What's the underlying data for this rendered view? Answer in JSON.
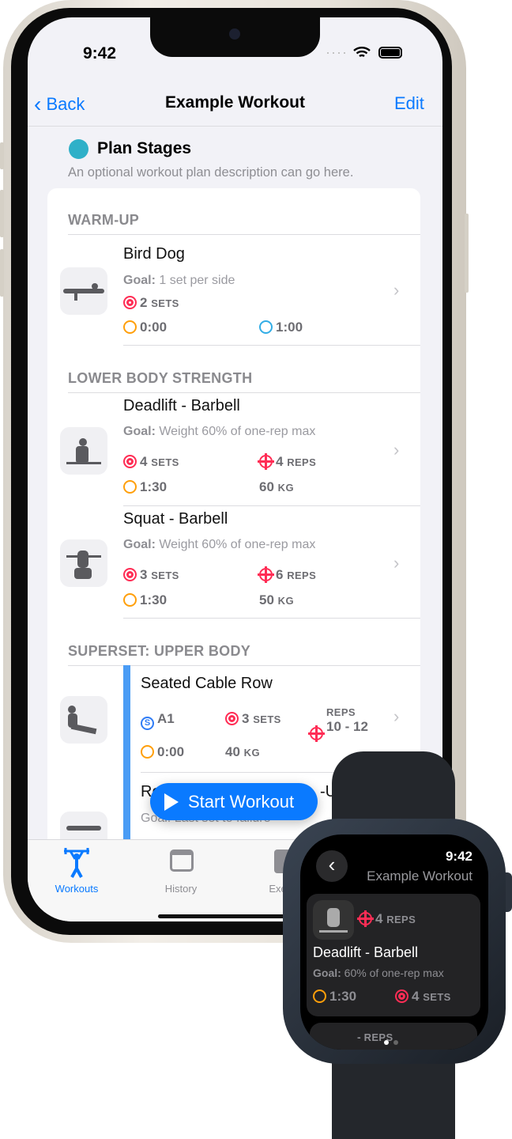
{
  "status": {
    "time": "9:42"
  },
  "nav": {
    "back": "Back",
    "title": "Example Workout",
    "edit": "Edit"
  },
  "plan": {
    "title": "Plan Stages",
    "description": "An optional workout plan description can go here."
  },
  "sections": [
    {
      "title": "WARM-UP",
      "items": [
        {
          "name": "Bird Dog",
          "goal_label": "Goal:",
          "goal": "1 set per side",
          "sets": "2",
          "sets_unit": "SETS",
          "rest": "0:00",
          "duration": "1:00"
        }
      ]
    },
    {
      "title": "LOWER BODY STRENGTH",
      "items": [
        {
          "name": "Deadlift - Barbell",
          "goal_label": "Goal:",
          "goal": "Weight 60% of one-rep max",
          "sets": "4",
          "sets_unit": "SETS",
          "reps": "4",
          "reps_unit": "REPS",
          "rest": "1:30",
          "weight": "60",
          "weight_unit": "KG"
        },
        {
          "name": "Squat - Barbell",
          "goal_label": "Goal:",
          "goal": "Weight 60% of one-rep max",
          "sets": "3",
          "sets_unit": "SETS",
          "reps": "6",
          "reps_unit": "REPS",
          "rest": "1:30",
          "weight": "50",
          "weight_unit": "KG"
        }
      ]
    },
    {
      "title": "SUPERSET: UPPER BODY",
      "items": [
        {
          "name": "Seated Cable Row",
          "superset": "A1",
          "sets": "3",
          "sets_unit": "SETS",
          "reps_unit": "REPS",
          "reps": "10 - 12",
          "rest": "0:00",
          "weight": "40",
          "weight_unit": "KG"
        },
        {
          "name_visible_start": "Ro",
          "name_visible_end": "-U",
          "goal": "Goal: Last set to failure"
        }
      ]
    }
  ],
  "start_button": "Start Workout",
  "tabs": [
    {
      "label": "Workouts",
      "active": true
    },
    {
      "label": "History"
    },
    {
      "label": "Exerc"
    }
  ],
  "colors": {
    "accent": "#0a7aff",
    "sets": "#ff2d55",
    "timer": "#ff9f0a",
    "clock": "#32ade6"
  },
  "watch": {
    "time": "9:42",
    "title": "Example Workout",
    "card": {
      "reps": "4",
      "reps_unit": "REPS",
      "name": "Deadlift - Barbell",
      "goal_label": "Goal:",
      "goal": "60% of one-rep max",
      "rest": "1:30",
      "sets": "4",
      "sets_unit": "SETS"
    },
    "next_reps_unit": "REPS",
    "next_reps": "-"
  }
}
